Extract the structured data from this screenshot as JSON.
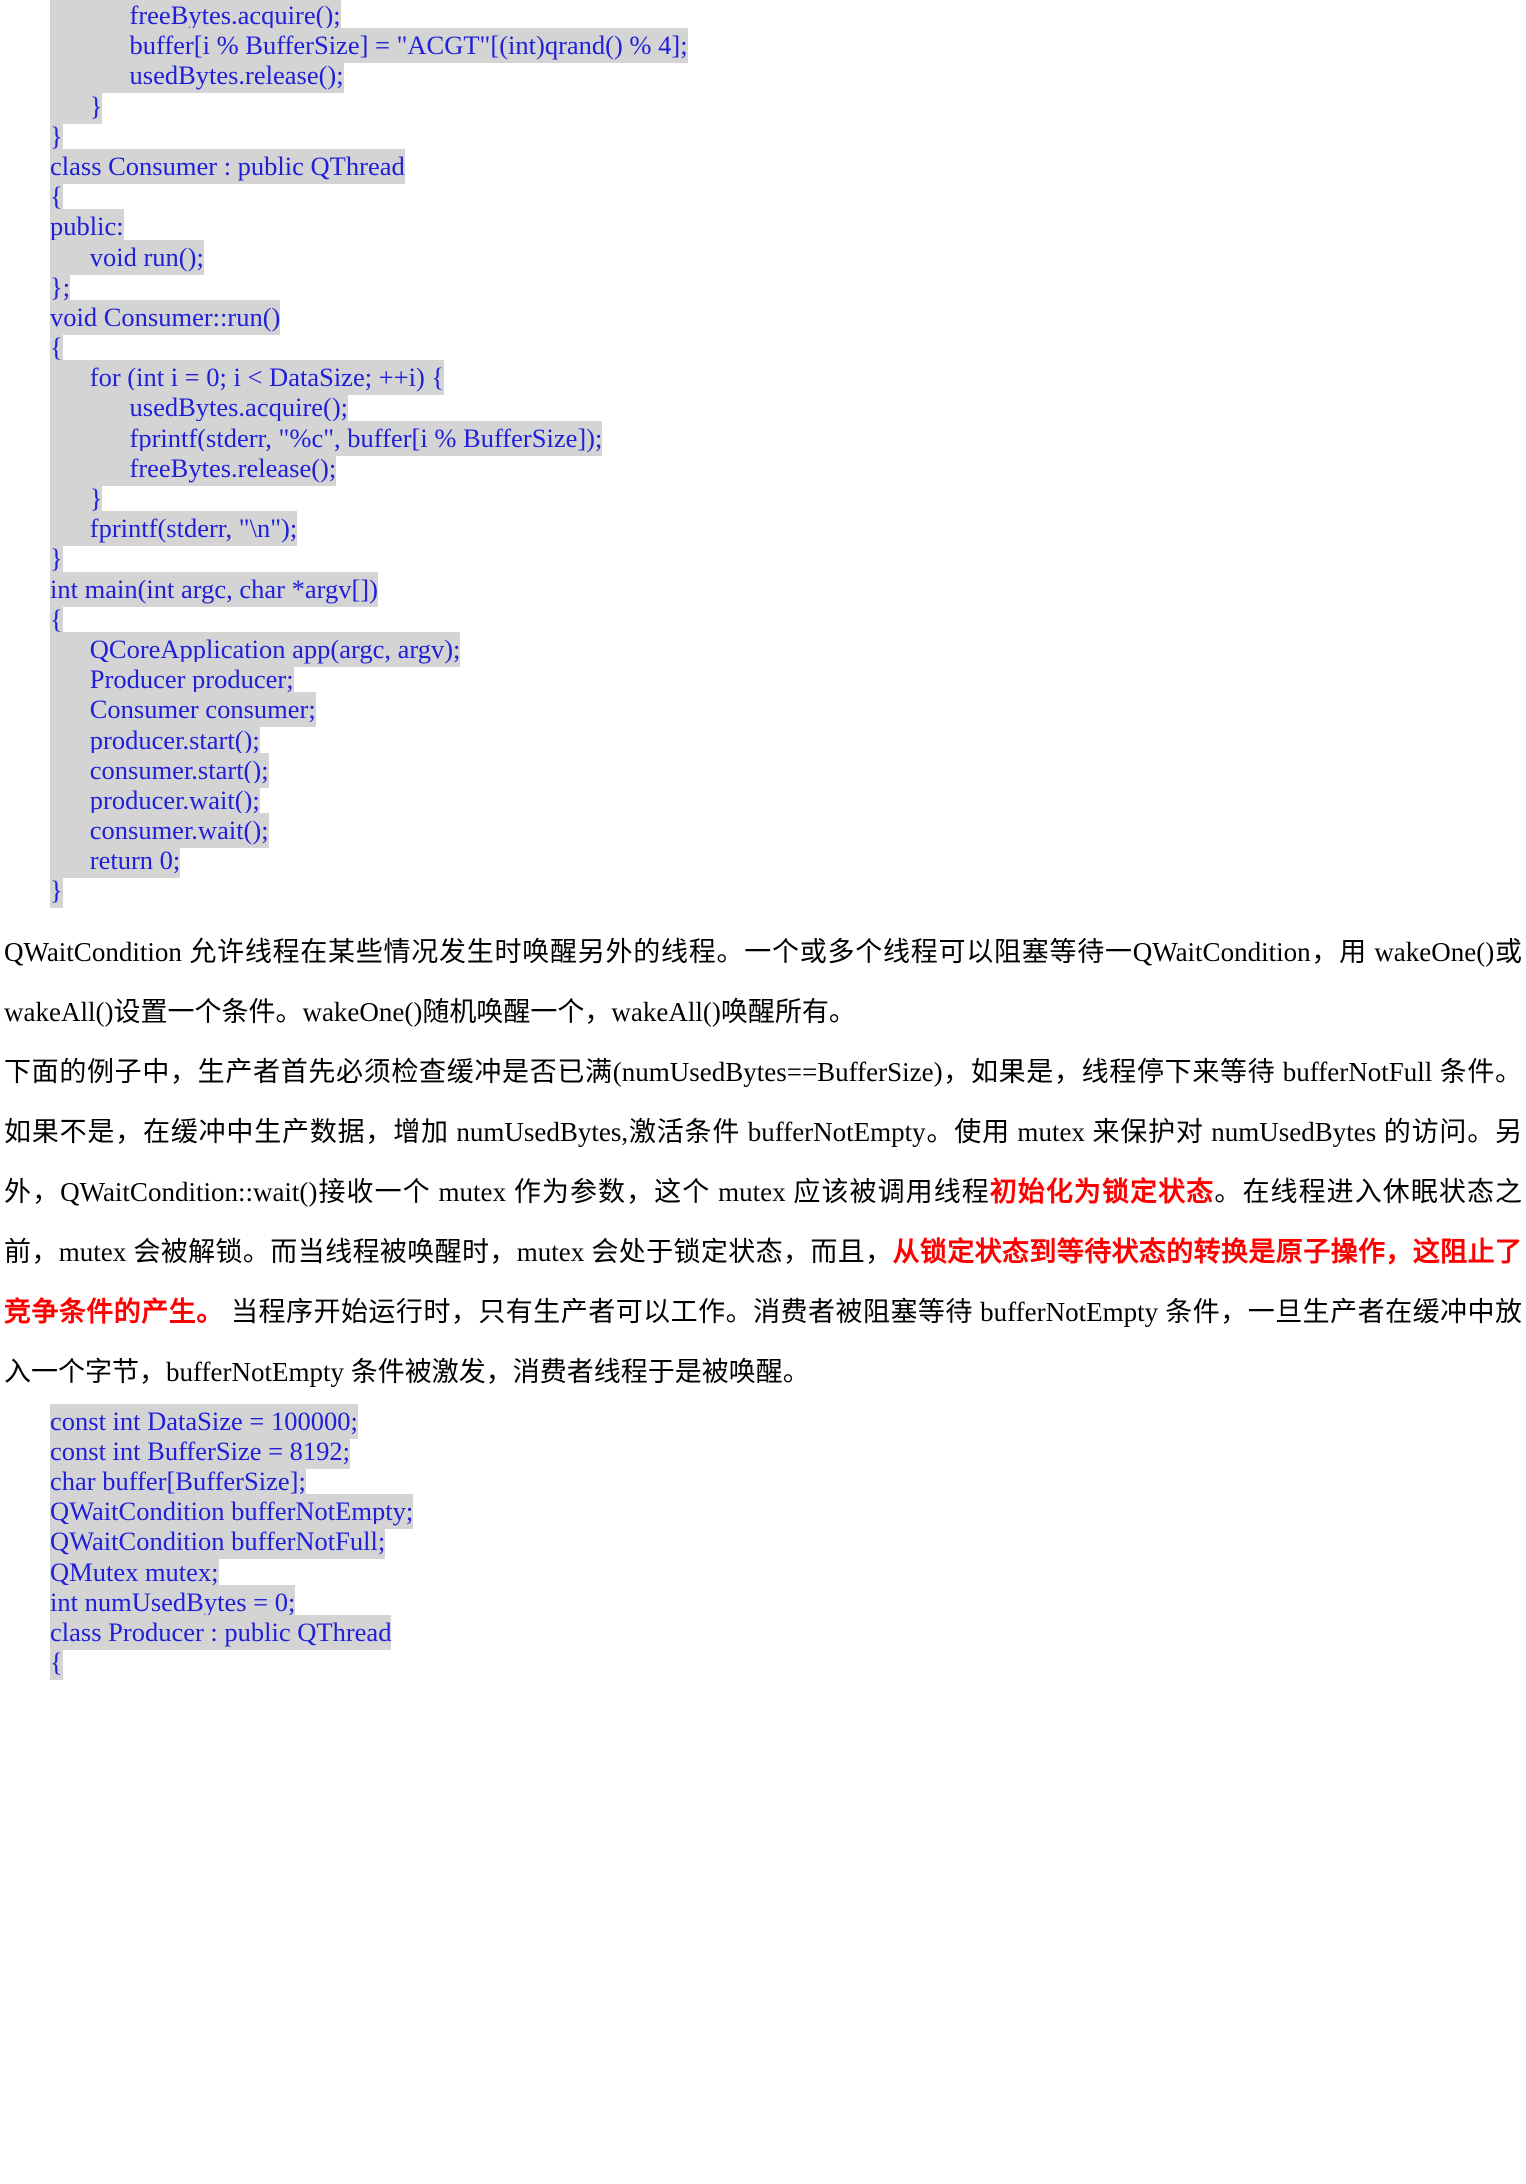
{
  "document": {
    "type": "technical-book-page",
    "language": "zh-CN",
    "topic": "Qt QWaitCondition / QSemaphore producer-consumer",
    "colors": {
      "code_text": "#1f1fd9",
      "code_highlight_bg": "#d4d4d4",
      "prose_text": "#000000",
      "emphasis_red": "#ff0000",
      "page_bg": "#ffffff"
    }
  },
  "code_block_top": {
    "name": "semaphore-producer-consumer-code",
    "lines": [
      "            freeBytes.acquire();",
      "            buffer[i % BufferSize] = \"ACGT\"[(int)qrand() % 4];",
      "            usedBytes.release();",
      "      }",
      "}",
      "class Consumer : public QThread",
      "{",
      "public:",
      "      void run();",
      "};",
      "void Consumer::run()",
      "{",
      "      for (int i = 0; i < DataSize; ++i) {",
      "            usedBytes.acquire();",
      "            fprintf(stderr, \"%c\", buffer[i % BufferSize]);",
      "            freeBytes.release();",
      "      }",
      "      fprintf(stderr, \"\\n\");",
      "}",
      "int main(int argc, char *argv[])",
      "{",
      "      QCoreApplication app(argc, argv);",
      "      Producer producer;",
      "      Consumer consumer;",
      "      producer.start();",
      "      consumer.start();",
      "      producer.wait();",
      "      consumer.wait();",
      "      return 0;",
      "}"
    ]
  },
  "paragraph_1": {
    "name": "qwaitcondition-intro",
    "runs": [
      {
        "text": "    QWaitCondition 允许线程在某些情况发生时唤醒另外的线程。一个或多个线程可以阻塞等待一QWaitCondition，用 wakeOne()或 wakeAll()设置一个条件。wakeOne()随机唤醒一个，wakeAll()唤醒所有。",
        "style": "normal"
      }
    ]
  },
  "paragraph_2": {
    "name": "producer-consumer-explanation",
    "runs": [
      {
        "text": "    下面的例子中，生产者首先必须检查缓冲是否已满(numUsedBytes==BufferSize)，如果是，线程停下来等待 bufferNotFull 条件。如果不是，在缓冲中生产数据，增加 numUsedBytes,激活条件 bufferNotEmpty。使用 mutex 来保护对 numUsedBytes 的访问。另外，QWaitCondition::wait()接收一个 mutex 作为参数，这个 mutex 应该被调用线程",
        "style": "normal"
      },
      {
        "text": "初始化为锁定状态",
        "style": "red-bold"
      },
      {
        "text": "。在线程进入休眠状态之前，mutex 会被解锁。而当线程被唤醒时，mutex 会处于锁定状态，而且，",
        "style": "normal"
      },
      {
        "text": "从锁定状态到等待状态的转换是原子操作，这阻止了竞争条件的产生。",
        "style": "red-bold"
      },
      {
        "text": " 当程序开始运行时，只有生产者可以工作。消费者被阻塞等待 bufferNotEmpty 条件，一旦生产者在缓冲中放入一个字节，bufferNotEmpty 条件被激发，消费者线程于是被唤醒。",
        "style": "normal"
      }
    ]
  },
  "code_block_bottom": {
    "name": "waitcondition-globals-code",
    "lines": [
      "const int DataSize = 100000;",
      "const int BufferSize = 8192;",
      "char buffer[BufferSize];",
      "QWaitCondition bufferNotEmpty;",
      "QWaitCondition bufferNotFull;",
      "QMutex mutex;",
      "int numUsedBytes = 0;",
      "class Producer : public QThread",
      "{"
    ]
  }
}
